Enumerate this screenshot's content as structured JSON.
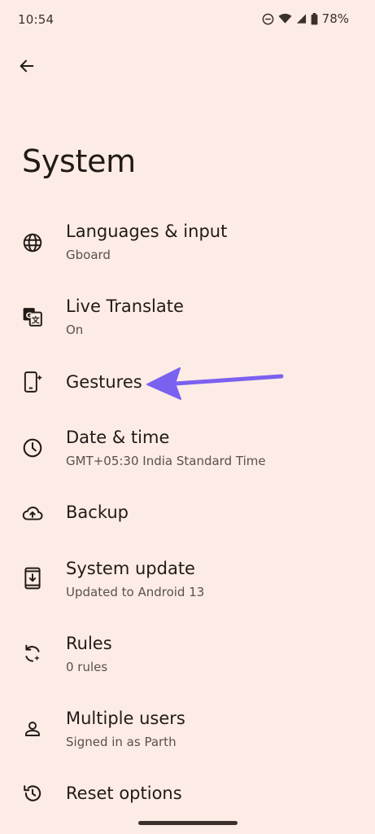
{
  "status": {
    "time": "10:54",
    "battery": "78%"
  },
  "header": {
    "title": "System"
  },
  "items": [
    {
      "title": "Languages & input",
      "subtitle": "Gboard",
      "icon": "globe-icon"
    },
    {
      "title": "Live Translate",
      "subtitle": "On",
      "icon": "translate-icon"
    },
    {
      "title": "Gestures",
      "subtitle": "",
      "icon": "gestures-phone-icon"
    },
    {
      "title": "Date & time",
      "subtitle": "GMT+05:30 India Standard Time",
      "icon": "clock-icon"
    },
    {
      "title": "Backup",
      "subtitle": "",
      "icon": "cloud-upload-icon"
    },
    {
      "title": "System update",
      "subtitle": "Updated to Android 13",
      "icon": "system-update-icon"
    },
    {
      "title": "Rules",
      "subtitle": "0 rules",
      "icon": "rules-icon"
    },
    {
      "title": "Multiple users",
      "subtitle": "Signed in as Parth",
      "icon": "person-icon"
    },
    {
      "title": "Reset options",
      "subtitle": "",
      "icon": "reset-icon"
    }
  ],
  "colors": {
    "background": "#fcece5",
    "annotation_arrow": "#7b61f0"
  }
}
